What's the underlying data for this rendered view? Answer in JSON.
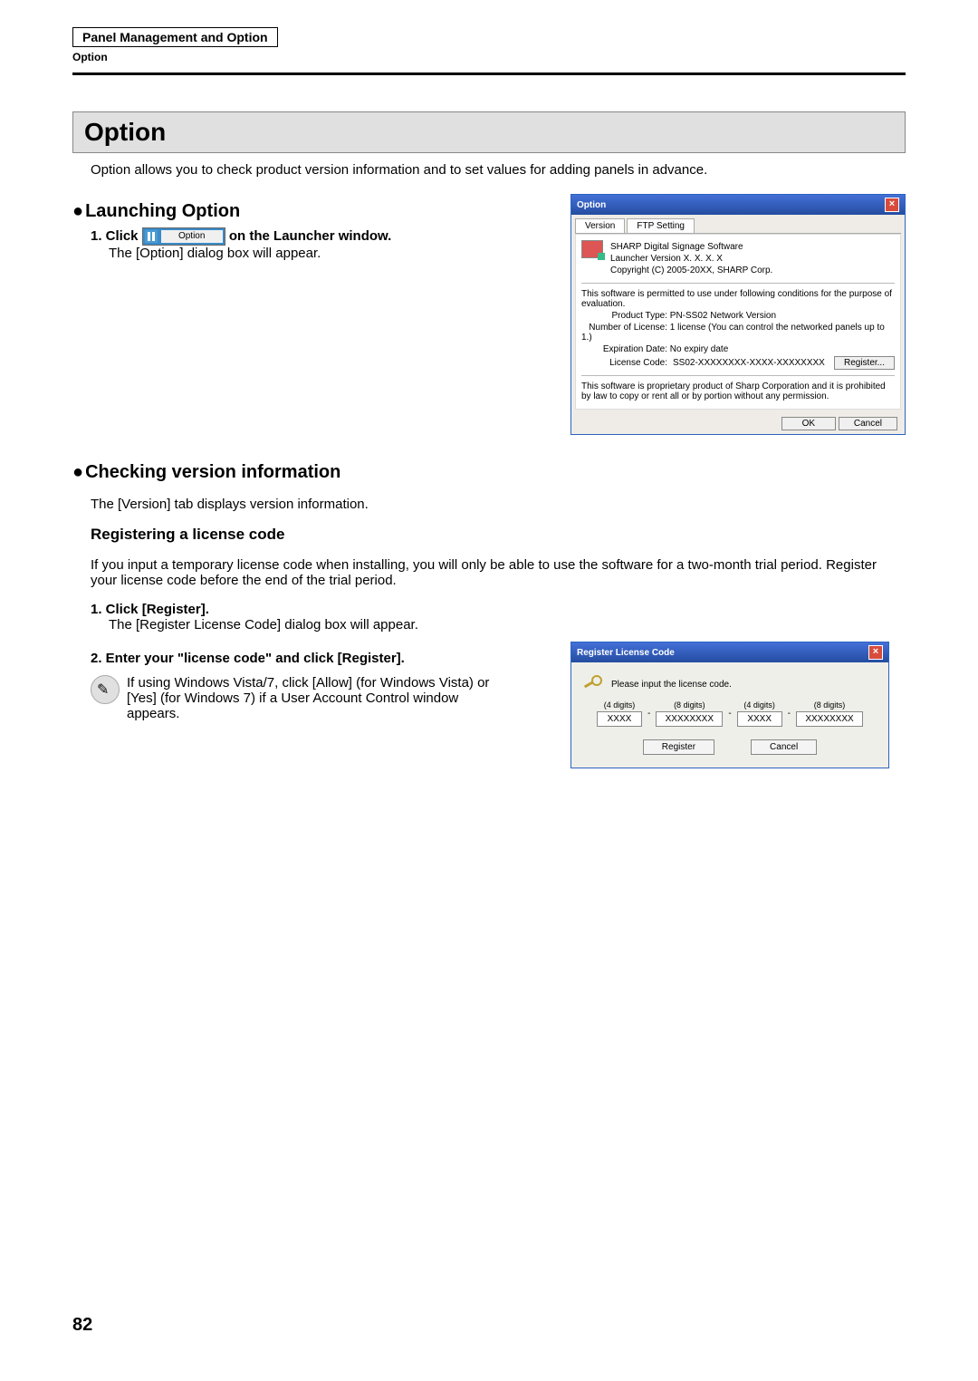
{
  "header": {
    "box": "Panel Management and Option",
    "sub": "Option"
  },
  "h1": "Option",
  "intro": "Option allows you to check product version information and to set values for adding panels in advance.",
  "launch": {
    "h": "Launching Option",
    "step1_pre": "1.  Click ",
    "btn_label": "Option",
    "step1_post": " on the Launcher window.",
    "sub": "The [Option] dialog box will appear."
  },
  "option_dialog": {
    "title": "Option",
    "tabs": [
      "Version",
      "FTP Setting"
    ],
    "line1": "SHARP Digital Signage Software",
    "line2": "Launcher   Version X. X. X. X",
    "line3": "Copyright (C) 2005-20XX, SHARP Corp.",
    "eval": "This software is permitted to use under following conditions for the purpose of evaluation.",
    "pt_label": "Product Type:",
    "pt_val": "PN-SS02   Network Version",
    "nl_label": "Number of License:",
    "nl_val": "1 license (You can control the networked panels up to 1.)",
    "ed_label": "Expiration Date:",
    "ed_val": "No expiry date",
    "lc_label": "License Code:",
    "lc_val": "SS02-XXXXXXXX-XXXX-XXXXXXXX",
    "register_btn": "Register...",
    "footer_note": "This software is proprietary product of Sharp Corporation and it is prohibited by law to copy or rent all or by portion without any permission.",
    "ok": "OK",
    "cancel": "Cancel"
  },
  "checking": {
    "h": "Checking version information",
    "p": "The [Version] tab displays version information.",
    "reg_h": "Registering a license code",
    "reg_p": "If you input a temporary license code when installing, you will only be able to use the software for a two-month trial period. Register your license code before the end of the trial period.",
    "s1": "1.  Click [Register].",
    "s1_sub": "The [Register License Code] dialog box will appear.",
    "s2": "2.  Enter your \"license code\" and click [Register].",
    "note": "If using Windows Vista/7, click [Allow] (for Windows Vista) or [Yes] (for Windows 7) if a User Account Control window appears."
  },
  "license_dialog": {
    "title": "Register License Code",
    "prompt": "Please input the license code.",
    "labels": [
      "(4 digits)",
      "(8 digits)",
      "(4 digits)",
      "(8 digits)"
    ],
    "vals": [
      "XXXX",
      "XXXXXXXX",
      "XXXX",
      "XXXXXXXX"
    ],
    "register": "Register",
    "cancel": "Cancel"
  },
  "page_num": "82",
  "dash": "-"
}
